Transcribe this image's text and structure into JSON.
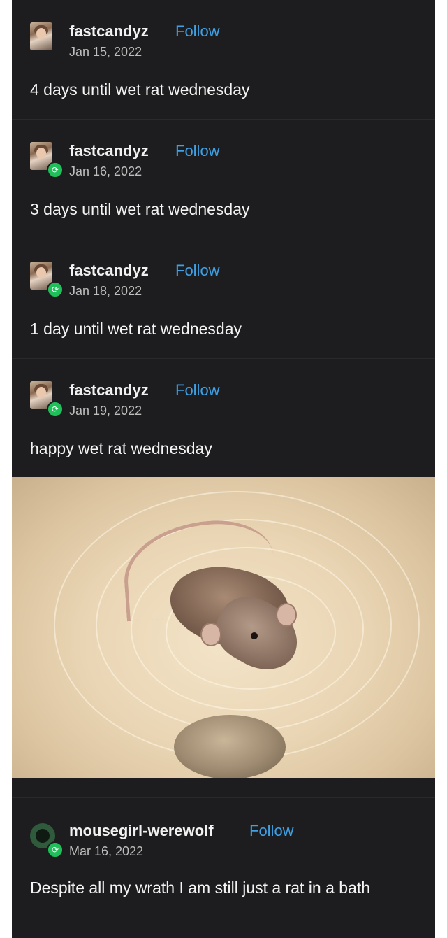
{
  "posts": [
    {
      "username": "fastcandyz",
      "follow": "Follow",
      "date": "Jan 15, 2022",
      "text": "4 days until wet rat wednesday",
      "reblog": false
    },
    {
      "username": "fastcandyz",
      "follow": "Follow",
      "date": "Jan 16, 2022",
      "text": "3 days until wet rat wednesday",
      "reblog": true
    },
    {
      "username": "fastcandyz",
      "follow": "Follow",
      "date": "Jan 18, 2022",
      "text": "1 day until wet rat wednesday",
      "reblog": true
    },
    {
      "username": "fastcandyz",
      "follow": "Follow",
      "date": "Jan 19, 2022",
      "text": "happy wet rat wednesday",
      "reblog": true
    },
    {
      "username": "mousegirl-werewolf",
      "follow": "Follow",
      "date": "Mar 16, 2022",
      "text": "Despite all my wrath I am still just a rat in a bath",
      "reblog": true
    }
  ],
  "icons": {
    "reblog": "reblog-icon",
    "avatar": "avatar-icon"
  },
  "colors": {
    "background": "#1d1d1f",
    "follow": "#3ea1e6",
    "reblog_badge": "#1fbf5a",
    "text": "#f4f4f4"
  },
  "reblog_glyph": "⟳"
}
